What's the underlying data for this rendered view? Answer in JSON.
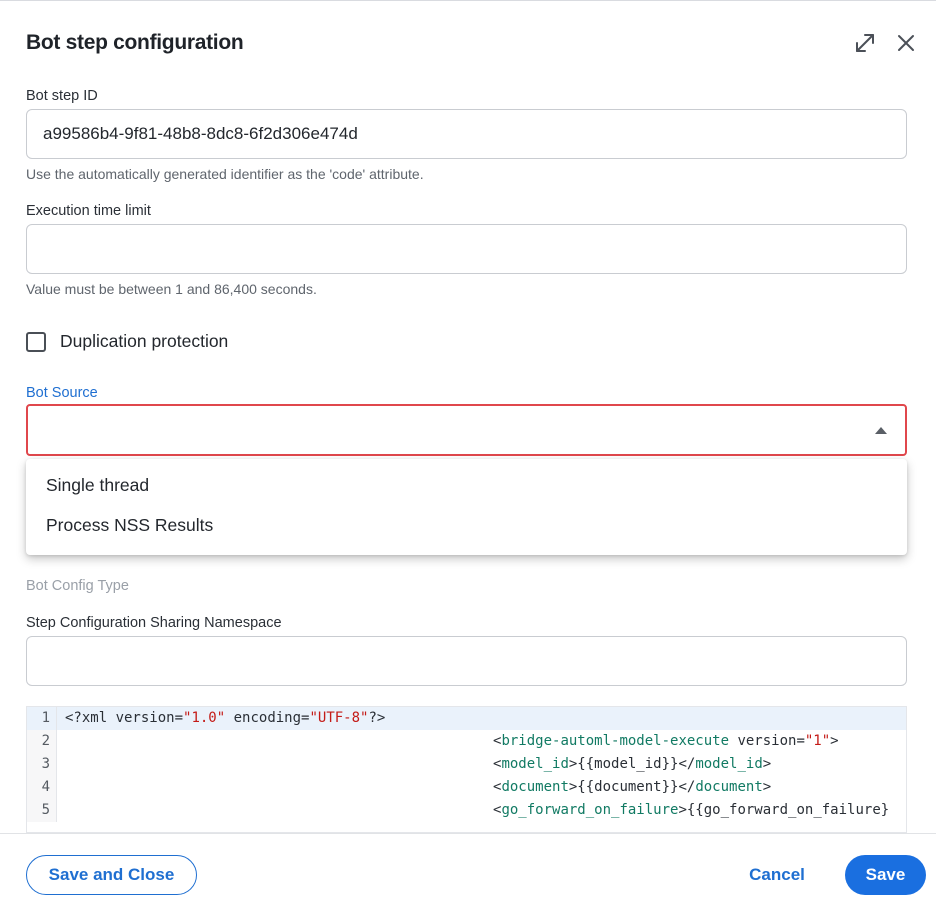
{
  "dialog": {
    "title": "Bot step configuration",
    "expand_icon": "expand-diagonal-arrows-icon",
    "close_icon": "close-x-icon"
  },
  "fields": {
    "bot_step_id": {
      "label": "Bot step ID",
      "value": "a99586b4-9f81-48b8-8dc8-6f2d306e474d",
      "help": "Use the automatically generated identifier as the 'code' attribute."
    },
    "execution_time_limit": {
      "label": "Execution time limit",
      "value": "",
      "help": "Value must be between 1 and 86,400 seconds."
    },
    "duplication_protection": {
      "label": "Duplication protection",
      "checked": false
    },
    "bot_source": {
      "label": "Bot Source",
      "value": "",
      "options": [
        "Single thread",
        "Process NSS Results"
      ],
      "error_color": "#e0474c"
    },
    "bot_config_type": {
      "label": "Bot Config Type"
    },
    "sharing_namespace": {
      "label": "Step Configuration Sharing Namespace",
      "value": ""
    }
  },
  "code_editor": {
    "line_numbers": [
      "1",
      "2",
      "3",
      "4",
      "5"
    ],
    "line1": {
      "open": "<?xml version=",
      "v1": "\"1.0\"",
      "mid": " encoding=",
      "v2": "\"UTF-8\"",
      "close": "?>"
    },
    "line2": {
      "lt": "<",
      "tag": "bridge-automl-model-execute",
      "attr": " version=",
      "val": "\"1\"",
      "gt": ">"
    },
    "line3": {
      "lt": "<",
      "tag": "model_id",
      "body": ">{{model_id}}</",
      "tag_close": "model_id",
      "gt": ">"
    },
    "line4": {
      "lt": "<",
      "tag": "document",
      "body": ">{{document}}</",
      "tag_close": "document",
      "gt": ">"
    },
    "line5": {
      "lt": "<",
      "tag": "go_forward_on_failure",
      "body": ">{{go_forward_on_failure}"
    }
  },
  "footer": {
    "save_and_close": "Save and Close",
    "cancel": "Cancel",
    "save": "Save"
  },
  "colors": {
    "accent": "#1f6fd1",
    "primary_button": "#1a6fe0",
    "error_border": "#e0474c"
  }
}
